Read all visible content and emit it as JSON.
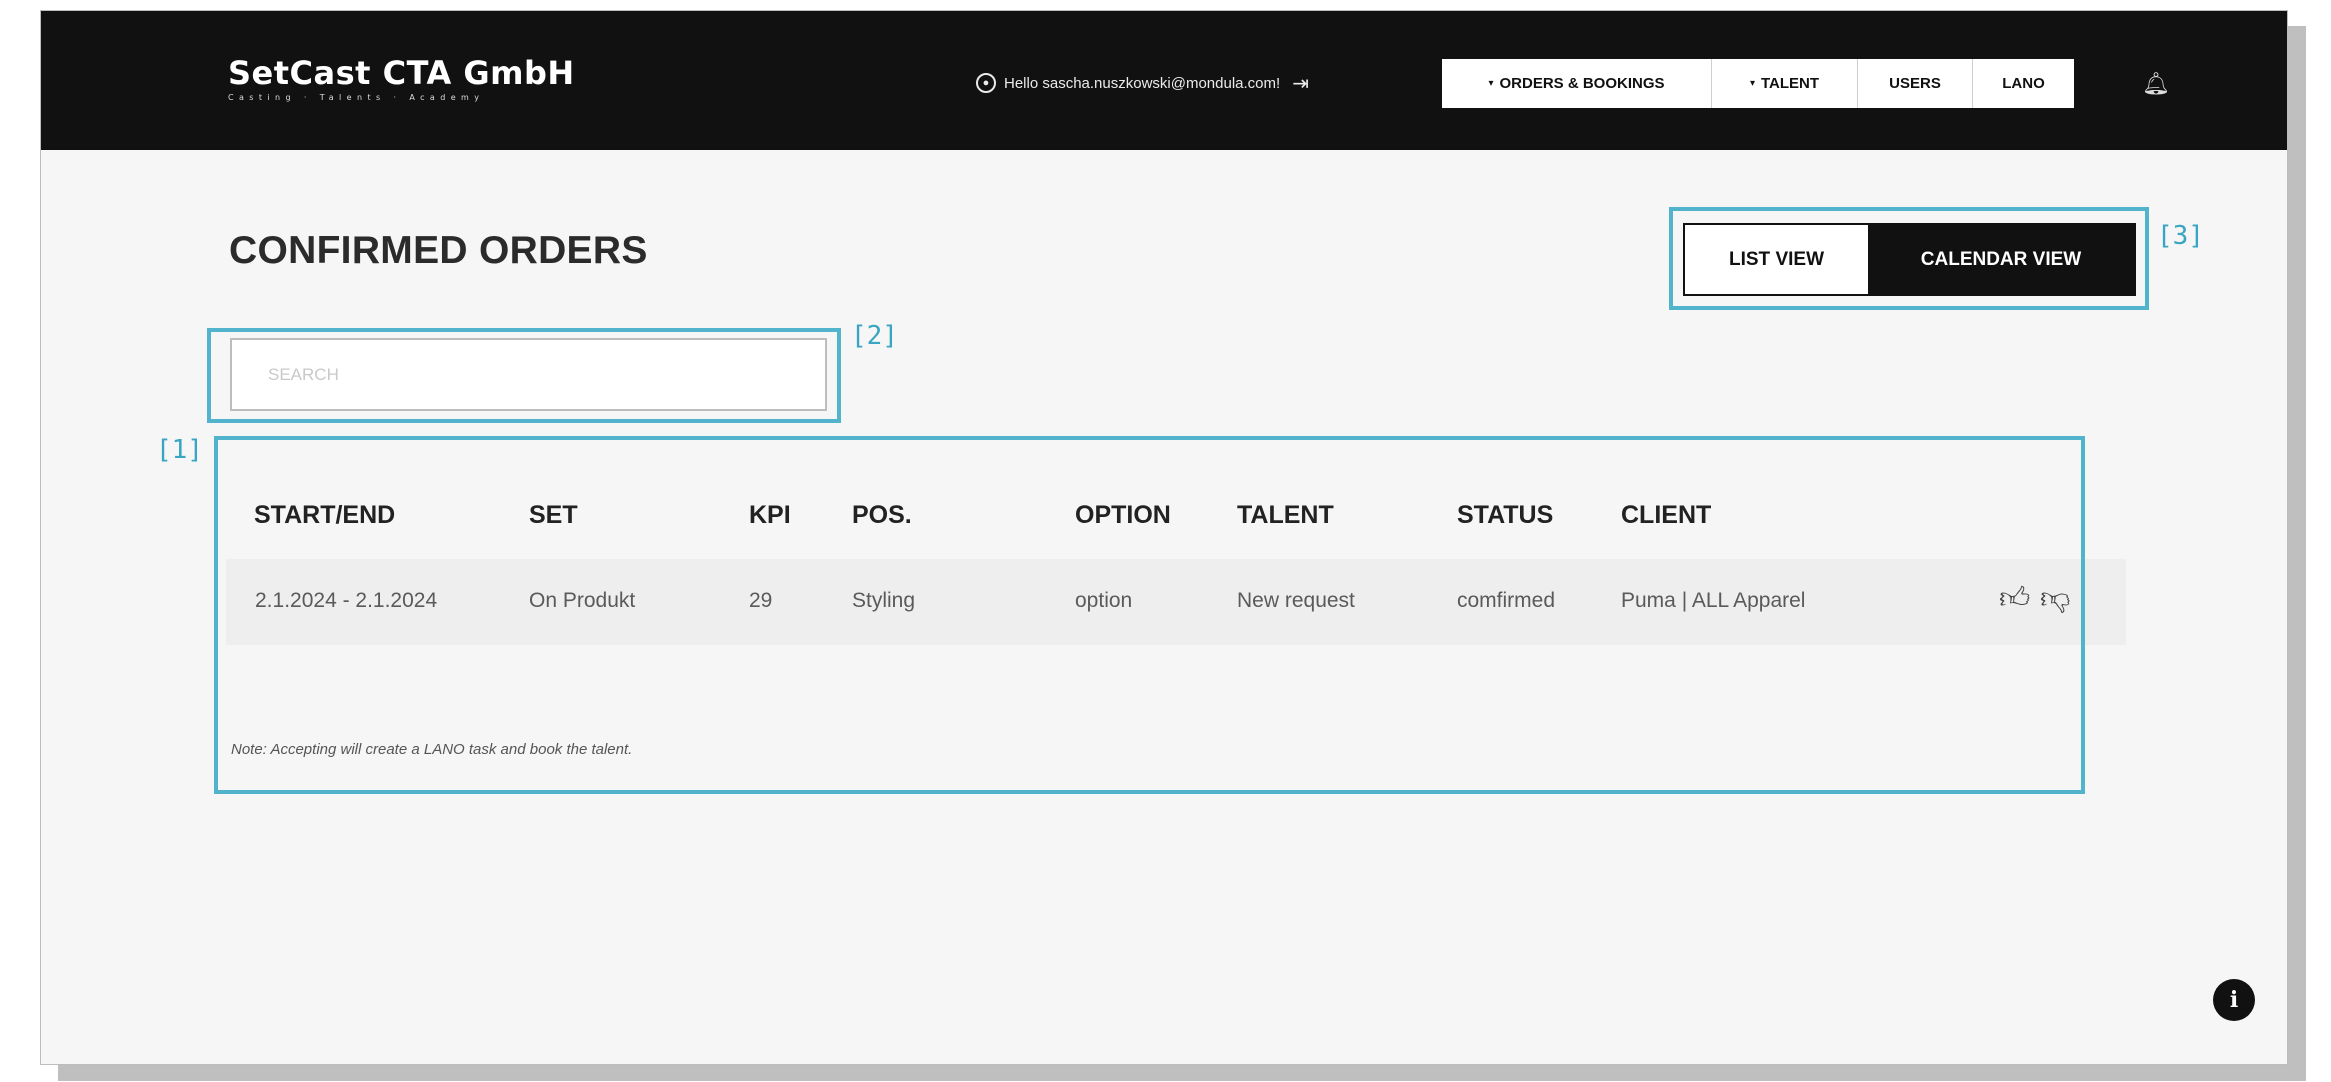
{
  "header": {
    "brand_name": "SetCast CTA GmbH",
    "brand_tagline": "Casting · Talents · Academy",
    "greeting": "Hello sascha.nuszkowski@mondula.com!",
    "nav": [
      {
        "label": "ORDERS & BOOKINGS",
        "caret": "▾"
      },
      {
        "label": "TALENT",
        "caret": "▾"
      },
      {
        "label": "USERS"
      },
      {
        "label": "LANO"
      }
    ],
    "icons": {
      "user": "user-circle-icon",
      "logout": "logout-icon",
      "bell": "bell-icon"
    }
  },
  "main": {
    "title": "CONFIRMED ORDERS",
    "view_toggle": {
      "list": "LIST VIEW",
      "calendar": "CALENDAR VIEW",
      "active": "calendar"
    },
    "search": {
      "placeholder": "SEARCH",
      "value": ""
    },
    "table": {
      "columns": [
        "START/END",
        "SET",
        "KPI",
        "POS.",
        "OPTION",
        "TALENT",
        "STATUS",
        "CLIENT"
      ],
      "rows": [
        {
          "start_end": "2.1.2024 - 2.1.2024",
          "set": "On Produkt",
          "kpi": "29",
          "pos": "Styling",
          "option": "option",
          "talent": "New request",
          "status": "comfirmed",
          "client": "Puma | ALL Apparel",
          "actions": [
            "thumbs-up-icon",
            "thumbs-down-icon"
          ]
        }
      ]
    },
    "note": "Note: Accepting will create a LANO task and book the talent."
  },
  "annotations": [
    "[1]",
    "[2]",
    "[3]"
  ],
  "colors": {
    "header_bg": "#111111",
    "annotation": "#52b4cc",
    "page_bg": "#f6f6f6"
  }
}
